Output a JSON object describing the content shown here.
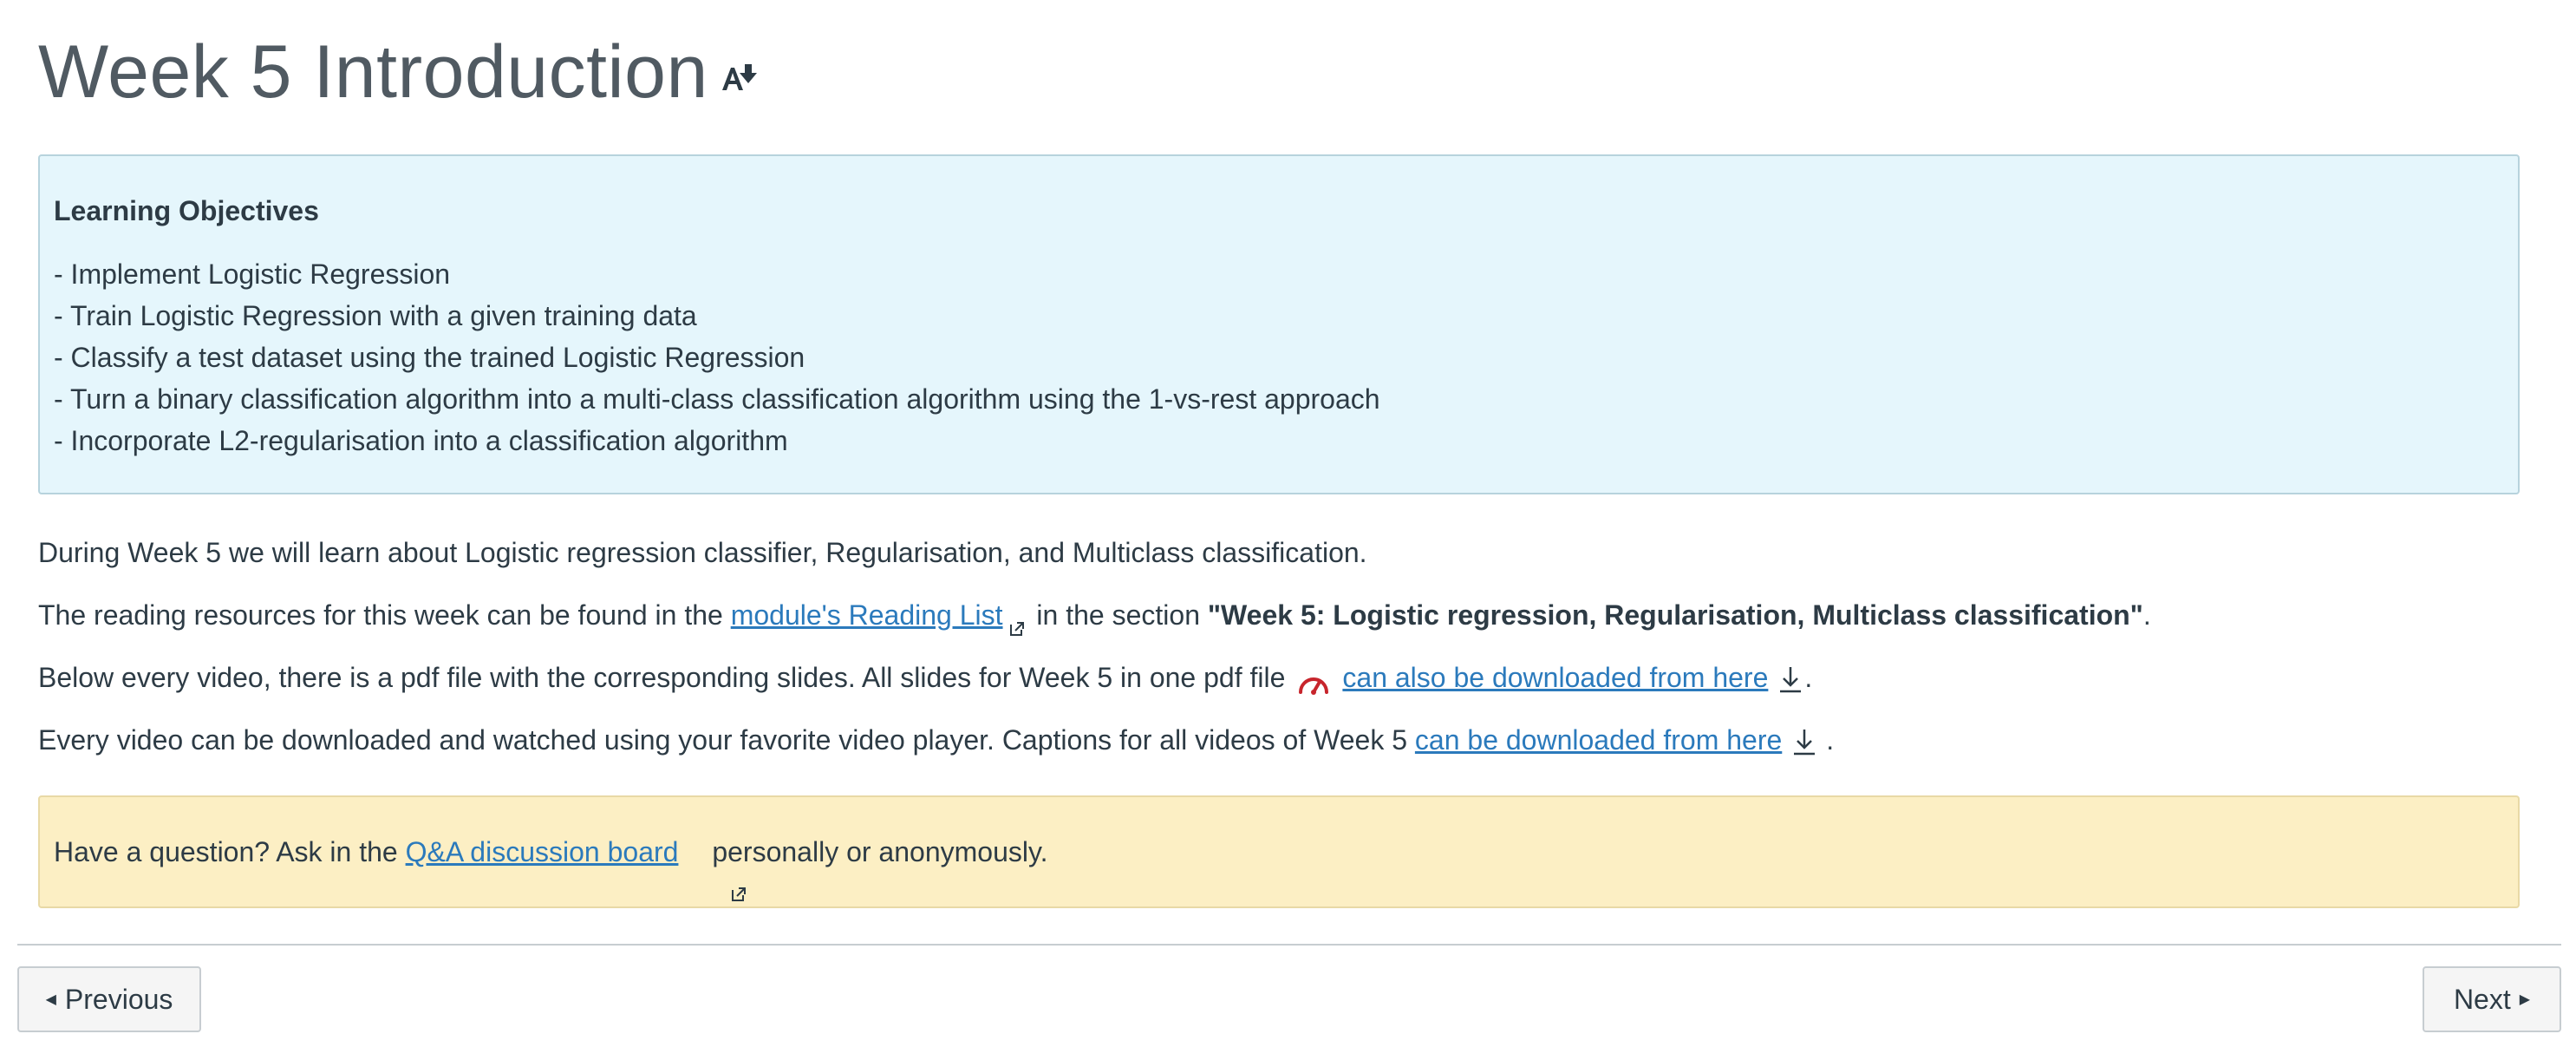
{
  "page": {
    "title": "Week 5 Introduction",
    "immersive_reader_icon": "immersive-reader-icon"
  },
  "objectives": {
    "heading": "Learning Objectives",
    "items": [
      "- Implement Logistic Regression",
      "- Train Logistic Regression with a given training data",
      "- Classify a test dataset using the trained Logistic Regression",
      "- Turn a binary classification algorithm into a multi-class classification algorithm using the 1-vs-rest approach",
      "- Incorporate L2-regularisation into a classification algorithm"
    ],
    "background_color": "#e5f6fc"
  },
  "body": {
    "p1": "During Week 5 we will learn about Logistic regression classifier, Regularisation, and Multiclass classification.",
    "p2": {
      "before": "The reading resources for this week can be found in the ",
      "link": "module's Reading List",
      "middle": " in the section ",
      "bold": "\"Week 5: Logistic regression, Regularisation, Multiclass classification\"",
      "after": "."
    },
    "p3": {
      "before": "Below every video, there is a pdf file with the corresponding slides. All slides for Week 5 in one pdf file",
      "link": "can also be downloaded from here",
      "after": "."
    },
    "p4": {
      "before": "Every video can be downloaded and watched using your favorite video player. Captions for all videos of Week 5 ",
      "link": "can be downloaded from here",
      "after": " ."
    }
  },
  "question": {
    "before": "Have a question? Ask in the ",
    "link": "Q&A discussion board",
    "after": " personally or anonymously.",
    "background_color": "#fcefc4"
  },
  "nav": {
    "previous_label": "Previous",
    "next_label": "Next"
  },
  "colors": {
    "link": "#2b7abc",
    "text": "#2d3b45",
    "pdf_icon": "#c7252c"
  }
}
